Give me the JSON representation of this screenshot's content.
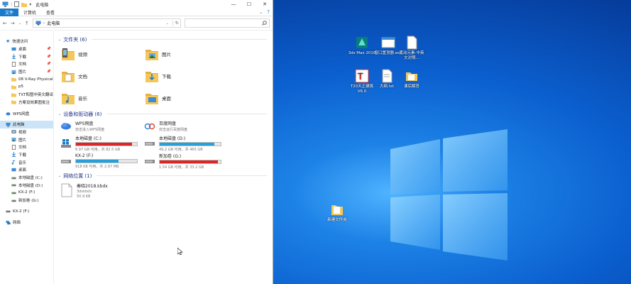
{
  "window": {
    "title": "此电脑",
    "controls": [
      "—",
      "☐",
      "✕"
    ]
  },
  "ribbon": {
    "tabs": [
      "文件",
      "计算机",
      "查看"
    ],
    "active": 0
  },
  "address": {
    "path": "此电脑",
    "search_placeholder": ""
  },
  "sidebar": {
    "quick_access": "快速访问",
    "quick_items": [
      {
        "label": "桌面",
        "icon": "desktop-icon",
        "pinned": true
      },
      {
        "label": "下载",
        "icon": "download-icon",
        "pinned": true
      },
      {
        "label": "文档",
        "icon": "document-icon",
        "pinned": true
      },
      {
        "label": "图片",
        "icon": "picture-icon",
        "pinned": true
      },
      {
        "label": "08 V-Ray Physical",
        "icon": "folder-icon",
        "pinned": false
      },
      {
        "label": "p5",
        "icon": "folder-icon",
        "pinned": false
      },
      {
        "label": "TXT和图中英文翻译",
        "icon": "folder-icon",
        "pinned": false
      },
      {
        "label": "方案设效果图批注",
        "icon": "folder-icon",
        "pinned": false
      }
    ],
    "wps": "WPS网盘",
    "this_pc": "此电脑",
    "pc_items": [
      {
        "label": "视频",
        "icon": "video-icon"
      },
      {
        "label": "图片",
        "icon": "picture-icon"
      },
      {
        "label": "文档",
        "icon": "document-icon"
      },
      {
        "label": "下载",
        "icon": "download-icon"
      },
      {
        "label": "音乐",
        "icon": "music-icon"
      },
      {
        "label": "桌面",
        "icon": "desktop-icon"
      },
      {
        "label": "本地磁盘 (C:)",
        "icon": "drive-icon"
      },
      {
        "label": "本地磁盘 (D:)",
        "icon": "drive-icon"
      },
      {
        "label": "KX-2 (F:)",
        "icon": "drive-icon"
      },
      {
        "label": "新加卷 (G:)",
        "icon": "drive-icon"
      }
    ],
    "kx2": "KX-2 (F:)",
    "network": "网络"
  },
  "folders": {
    "header": "文件夹 (6)",
    "items": [
      {
        "label": "视频",
        "icon": "video-folder-icon"
      },
      {
        "label": "图片",
        "icon": "picture-folder-icon"
      },
      {
        "label": "文档",
        "icon": "document-folder-icon"
      },
      {
        "label": "下载",
        "icon": "download-folder-icon"
      },
      {
        "label": "音乐",
        "icon": "music-folder-icon"
      },
      {
        "label": "桌面",
        "icon": "desktop-folder-icon"
      }
    ]
  },
  "devices": {
    "header": "设备和驱动器 (6)",
    "items": [
      {
        "name": "WPS网盘",
        "sub": "双击进入WPS网盘",
        "icon": "wps-cloud-icon",
        "type": "app"
      },
      {
        "name": "百度网盘",
        "sub": "双击运行百度网盘",
        "icon": "baidu-cloud-icon",
        "type": "app"
      },
      {
        "name": "本地磁盘 (C:)",
        "sub": "6.97 GB 可用，共 82.5 GB",
        "icon": "windows-drive-icon",
        "type": "drive",
        "used": 0.915,
        "color": "#da2626"
      },
      {
        "name": "本地磁盘 (D:)",
        "sub": "49.2 GB 可用，共 465 GB",
        "icon": "drive-icon",
        "type": "drive",
        "used": 0.894,
        "color": "#26a0da"
      },
      {
        "name": "KX-2 (F:)",
        "sub": "918 KB 可用，共 2.97 MB",
        "icon": "drive-icon",
        "type": "drive",
        "used": 0.7,
        "color": "#26a0da"
      },
      {
        "name": "新加卷 (G:)",
        "sub": "1.54 GB 可用，共 33.2 GB",
        "icon": "drive-icon",
        "type": "drive",
        "used": 0.954,
        "color": "#da2626"
      }
    ]
  },
  "network": {
    "header": "网络位置 (1)",
    "items": [
      {
        "name": "秦晓2018.kbdx",
        "sub1": "3dskbdx",
        "sub2": "50.9 KB",
        "icon": "file-icon"
      }
    ]
  },
  "desktop": {
    "icons": [
      {
        "label": "3ds Max 2016",
        "icon": "3dsmax-icon"
      },
      {
        "label": "窗口置顶器.exe",
        "icon": "exe-window-icon"
      },
      {
        "label": "宽动元素-中英文对照...",
        "icon": "text-file-icon"
      },
      {
        "label": "T20天正建筑 V6.0",
        "icon": "tarch-icon"
      },
      {
        "label": "大纲.txt",
        "icon": "text-file-icon"
      },
      {
        "label": "课后解答",
        "icon": "folder-icon"
      },
      {
        "label": "新建文件夹",
        "icon": "folder-icon"
      }
    ]
  }
}
